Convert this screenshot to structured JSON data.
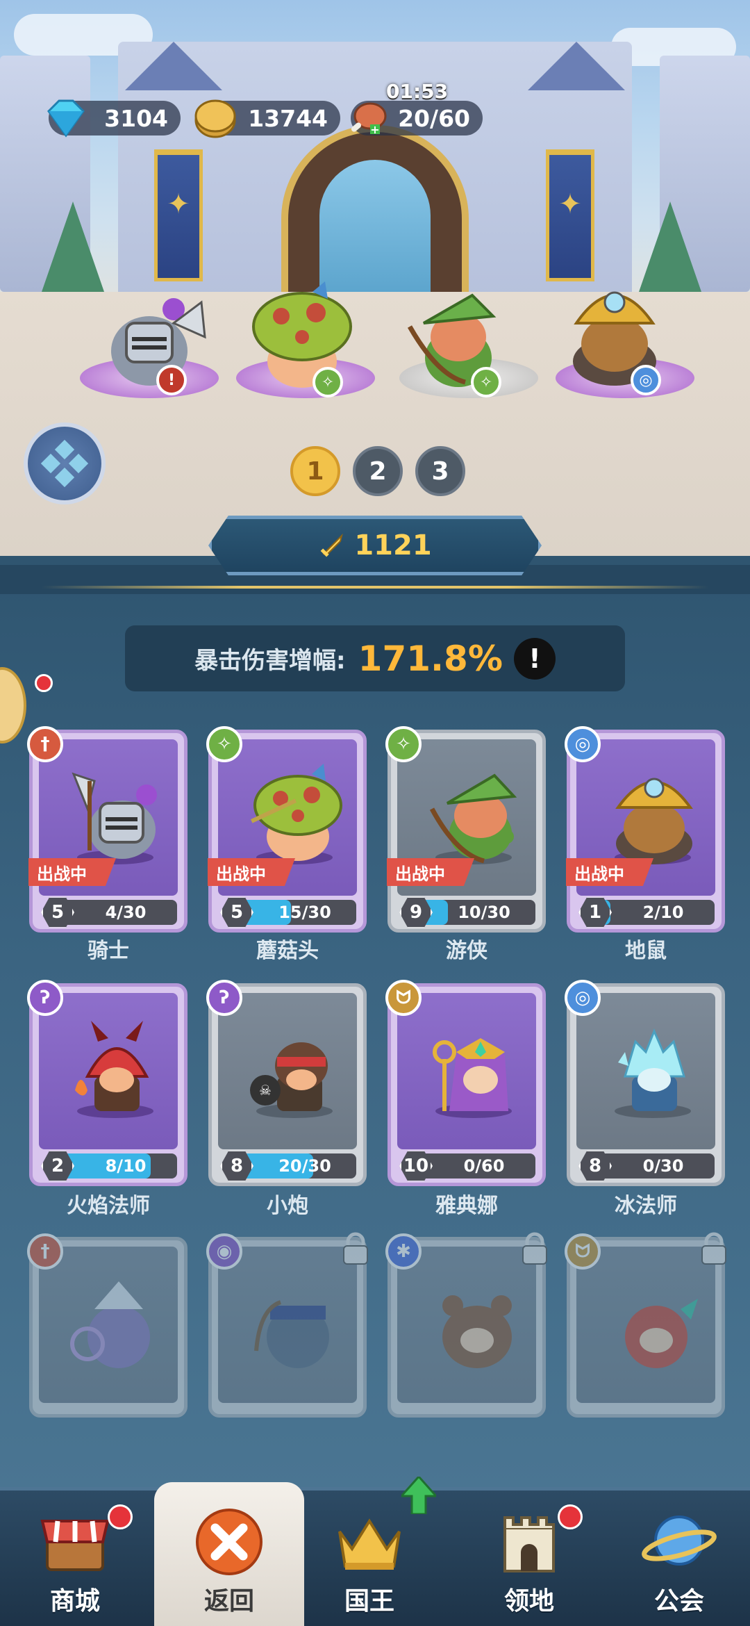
{
  "resources": {
    "gems": "3104",
    "gold": "13744",
    "energy": "20/60",
    "energy_timer": "01:53"
  },
  "team_tabs": [
    "1",
    "2",
    "3"
  ],
  "active_team": "1",
  "team_power": "1121",
  "stat": {
    "label": "暴击伤害增幅:",
    "value": "171.8%",
    "info": "!"
  },
  "deploy_tag": "出战中",
  "heroes": [
    {
      "name": "骑士",
      "level": "5",
      "progress": "4/30",
      "fill": 0.13,
      "deployed": true,
      "type": "sword"
    },
    {
      "name": "蘑菇头",
      "level": "5",
      "progress": "15/30",
      "fill": 0.5,
      "deployed": true,
      "type": "swirl"
    },
    {
      "name": "游侠",
      "level": "9",
      "progress": "10/30",
      "fill": 0.33,
      "deployed": true,
      "type": "swirl"
    },
    {
      "name": "地鼠",
      "level": "1",
      "progress": "2/10",
      "fill": 0.2,
      "deployed": true,
      "type": "spiral"
    },
    {
      "name": "火焰法师",
      "level": "2",
      "progress": "8/10",
      "fill": 0.8,
      "deployed": false,
      "type": "staff"
    },
    {
      "name": "小炮",
      "level": "8",
      "progress": "20/30",
      "fill": 0.67,
      "deployed": false,
      "type": "staff"
    },
    {
      "name": "雅典娜",
      "level": "10",
      "progress": "0/60",
      "fill": 0,
      "deployed": false,
      "type": "wings"
    },
    {
      "name": "冰法师",
      "level": "8",
      "progress": "0/30",
      "fill": 0,
      "deployed": false,
      "type": "spiral"
    }
  ],
  "nav": [
    {
      "label": "商城",
      "icon": "shop-icon"
    },
    {
      "label": "返回",
      "icon": "close-icon"
    },
    {
      "label": "国王",
      "icon": "crown-icon"
    },
    {
      "label": "领地",
      "icon": "castle-icon"
    },
    {
      "label": "公会",
      "icon": "planet-icon"
    }
  ],
  "colors": {
    "accent_gold": "#ffb83a",
    "deploy_red": "#e05348",
    "progress_blue": "#38b4e6",
    "card_purple": "#8e6fcb"
  }
}
